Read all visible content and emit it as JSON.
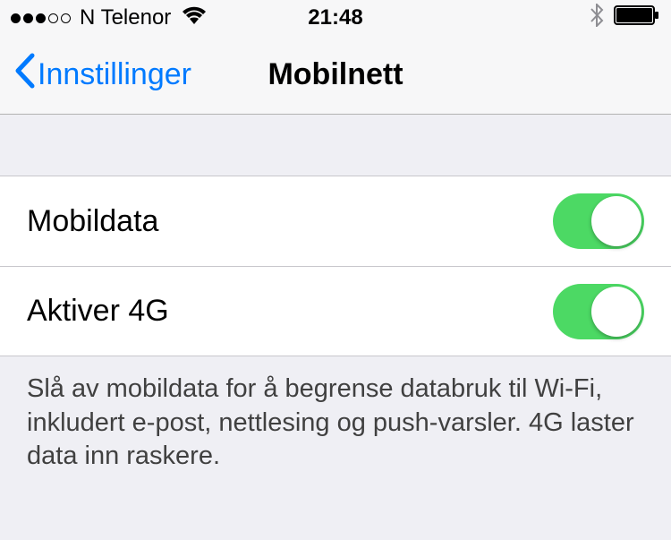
{
  "statusBar": {
    "carrier": "N Telenor",
    "time": "21:48"
  },
  "navBar": {
    "backLabel": "Innstillinger",
    "title": "Mobilnett"
  },
  "settings": {
    "rows": [
      {
        "label": "Mobildata",
        "on": true
      },
      {
        "label": "Aktiver 4G",
        "on": true
      }
    ],
    "footer": "Slå av mobildata for å begrense databruk til Wi-Fi, inkludert e-post, nettlesing og push-varsler. 4G laster data inn raskere."
  },
  "colors": {
    "accent": "#007aff",
    "toggleOn": "#4cd964",
    "pageBg": "#efeff4"
  }
}
